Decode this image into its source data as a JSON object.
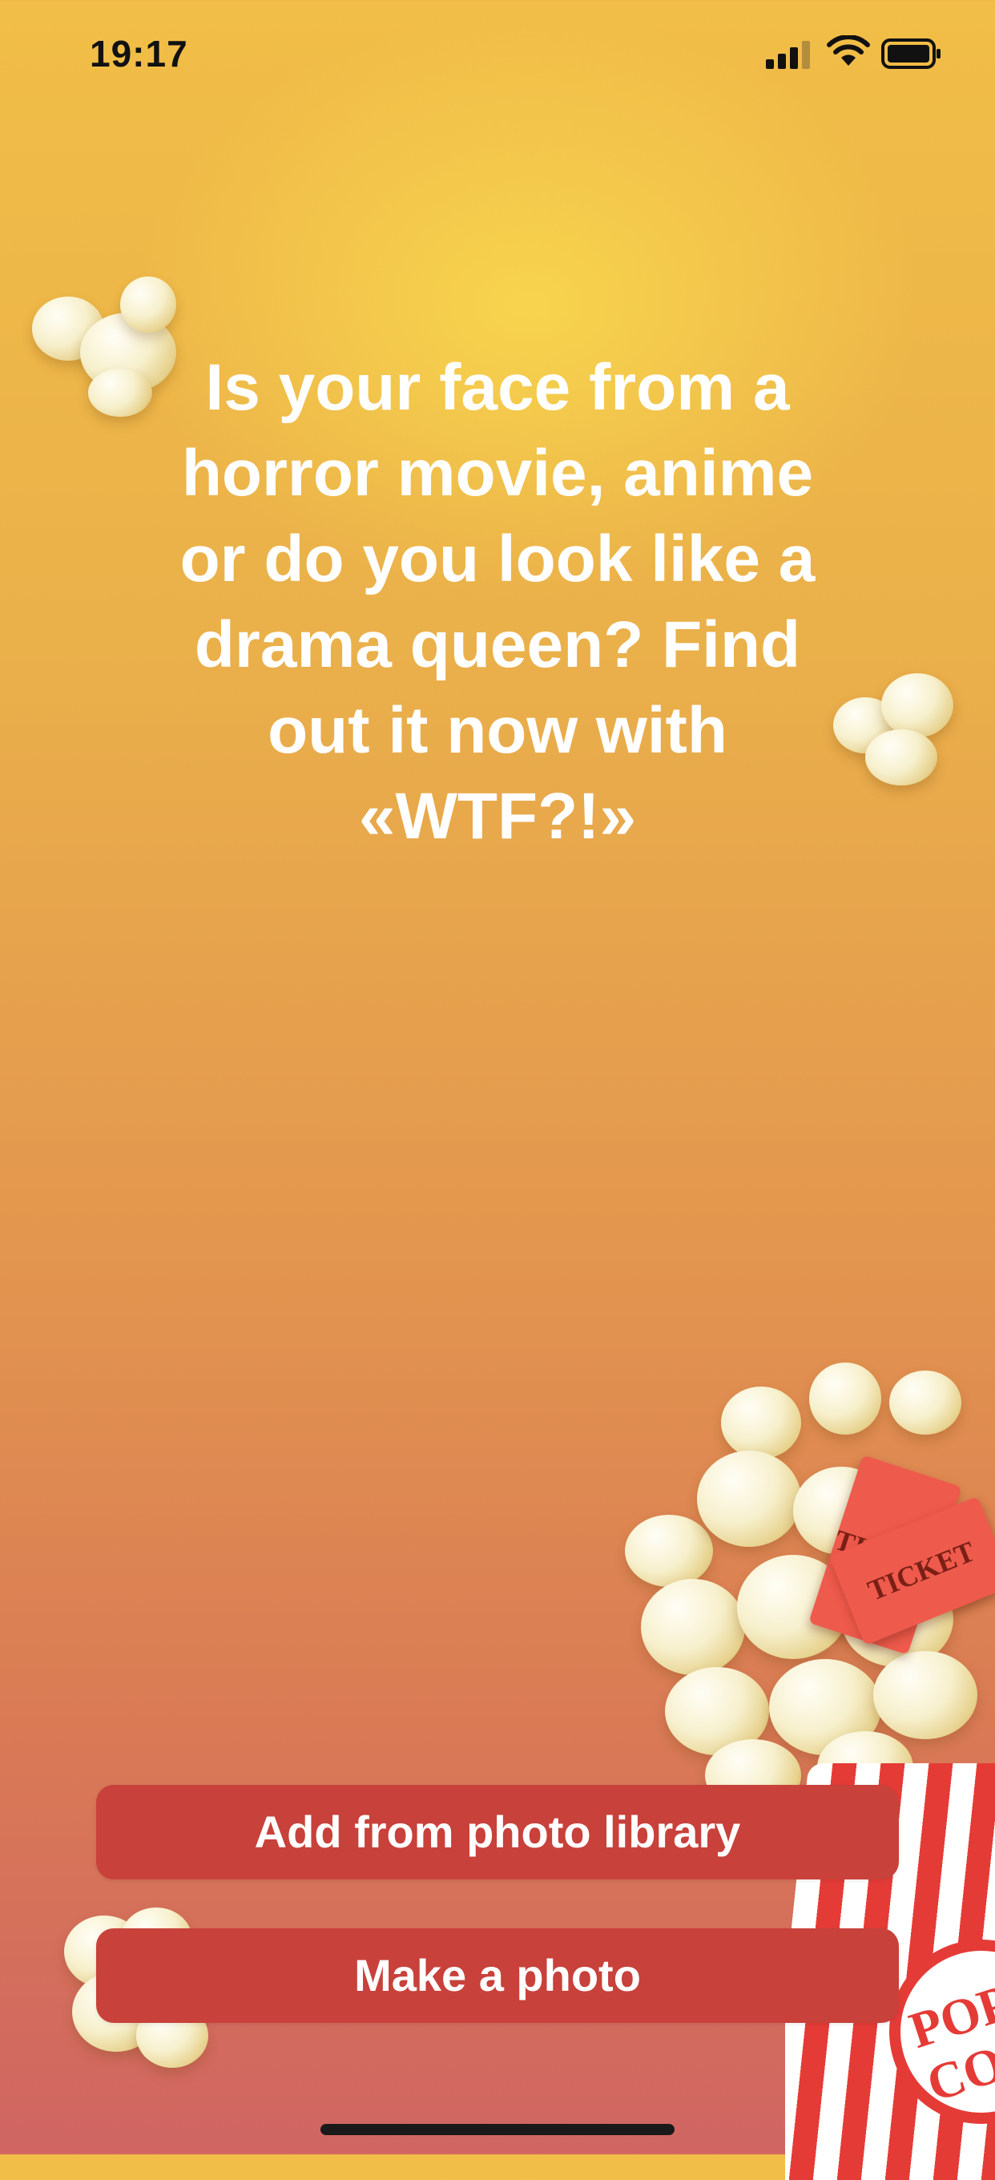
{
  "status_bar": {
    "time": "19:17"
  },
  "headline": "Is your face from a\nhorror movie, anime\nor do you look like a\ndrama queen? Find\nout it now with\n«WTF?!»",
  "decoration": {
    "ticket_1": "TICKET",
    "ticket_2": "TICKET",
    "bucket_label": "POP\nCORN"
  },
  "actions": {
    "library_label": "Add from photo library",
    "camera_label": "Make a photo"
  },
  "colors": {
    "button": "#c8413b",
    "accent_red": "#e53b37"
  }
}
